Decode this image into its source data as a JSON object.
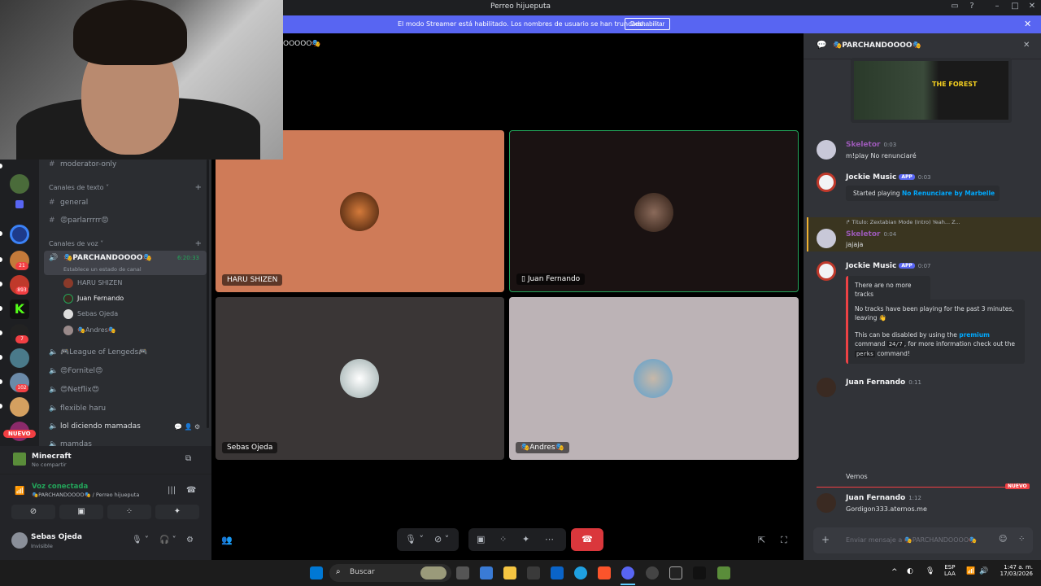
{
  "window": {
    "title": "Perreo hijueputa"
  },
  "banner": {
    "message": "El modo Streamer está habilitado. Los nombres de usuario se han truncado.",
    "button": "Deshabilitar"
  },
  "server_badges": [
    "21",
    "893",
    "7",
    "102"
  ],
  "nuevo_badge": "NUEVO",
  "sidebar": {
    "top_channel": "moderator-only",
    "text_category": "Canales de texto",
    "text_channels": [
      "general",
      "😡parlarrrrr😡"
    ],
    "voice_category": "Canales de voz",
    "active_voice": {
      "name": "🎭PARCHANDOOOO🎭",
      "status": "Establece un estado de canal",
      "timer": "6:20:33"
    },
    "voice_users": [
      "HARU SHIZEN",
      "Juan Fernando",
      "Sebas Ojeda",
      "🎭Andres🎭"
    ],
    "other_voice": [
      "🎮League of Lengeds🎮",
      "😍Fornitel😍",
      "😍Netflix😍",
      "flexible haru",
      "lol diciendo mamadas",
      "mamdas"
    ]
  },
  "activity": {
    "game": "Minecraft",
    "sub": "No compartir"
  },
  "voice": {
    "status": "Voz conectada",
    "location": "🎭PARCHANDOOOO🎭 / Perreo hijueputa"
  },
  "user": {
    "name": "Sebas Ojeda",
    "status": "Invisible"
  },
  "stage": {
    "header": "OOOOO🎭",
    "tiles": [
      {
        "name": "HARU SHIZEN",
        "bg": "#cf7b58",
        "speaking": false
      },
      {
        "name": "Juan Fernando",
        "bg": "#1a1212",
        "speaking": true
      },
      {
        "name": "Sebas Ojeda",
        "bg": "#3a3636",
        "speaking": false
      },
      {
        "name": "🎭Andres🎭",
        "bg": "#bcb3b6",
        "speaking": false
      }
    ]
  },
  "chat": {
    "title": "🎭PARCHANDOOOO🎭",
    "game_image": "THE FOREST",
    "messages": [
      {
        "author": "Skeletor",
        "time": "0:03",
        "text": "m!play No renunciaré"
      },
      {
        "author": "Jockie Music",
        "app": "APP",
        "time": "0:03",
        "embed_prefix": "Started playing ",
        "embed_link": "No Renunciare by Marbelle"
      },
      {
        "reply": "Titulo: Zextabian Mode (Intro) Yeah... Z...",
        "author": "Skeletor",
        "time": "0:04",
        "text": "jajaja"
      },
      {
        "author": "Jockie Music",
        "app": "APP",
        "time": "0:07",
        "embed1": "There are no more tracks",
        "embed2a": "No tracks have been playing for the past 3 minutes, leaving 👋",
        "embed2b": "This can be disabled by using the ",
        "embed2_link": "premium",
        "embed2c": " command ",
        "embed2_code": "24/7",
        "embed2d": ", for more information check out the ",
        "embed2_code2": "perks",
        "embed2e": " command!"
      },
      {
        "author": "Juan Fernando",
        "time": "0:11"
      }
    ],
    "separator_text": "Vemos",
    "new_badge": "NUEVO",
    "last": {
      "author": "Juan Fernando",
      "time": "1:12",
      "text": "Gordigon333.aternos.me"
    },
    "input_placeholder": "Enviar mensaje a 🎭PARCHANDOOOO🎭"
  },
  "taskbar": {
    "search": "Buscar",
    "lang1": "ESP",
    "lang2": "LAA",
    "time": "1:47 a. m.",
    "date": "17/03/2026"
  }
}
